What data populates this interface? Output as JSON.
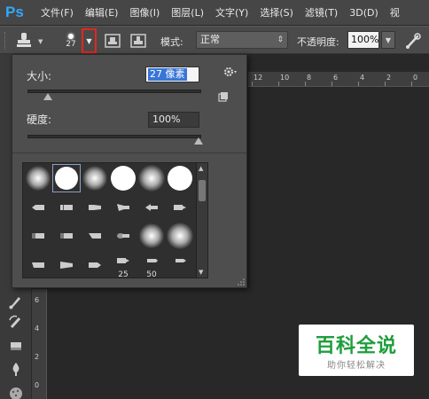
{
  "app": {
    "logo": "Ps"
  },
  "menu": [
    "文件(F)",
    "编辑(E)",
    "图像(I)",
    "图层(L)",
    "文字(Y)",
    "选择(S)",
    "滤镜(T)",
    "3D(D)",
    "视"
  ],
  "options": {
    "brush_size_value": "27",
    "mode_label": "模式:",
    "mode_value": "正常",
    "opacity_label": "不透明度:",
    "opacity_value": "100%"
  },
  "brush_panel": {
    "size_label": "大小:",
    "size_value": "27 像素",
    "size_level": 0.1,
    "hardness_label": "硬度:",
    "hardness_value": "100%",
    "hardness_level": 1.0,
    "preset_labels": [
      "25",
      "50"
    ]
  },
  "ruler": {
    "top": [
      "12",
      "10",
      "8",
      "6",
      "4",
      "2",
      "0"
    ],
    "left": [
      "6",
      "4",
      "2",
      "0"
    ]
  },
  "watermark": {
    "title": "百科全说",
    "subtitle": "助你轻松解决"
  },
  "colors": {
    "accent_red": "#e0281e",
    "selection_blue": "#3875d7",
    "watermark_green": "#1e9e3c",
    "ps_blue": "#31a8ff"
  }
}
